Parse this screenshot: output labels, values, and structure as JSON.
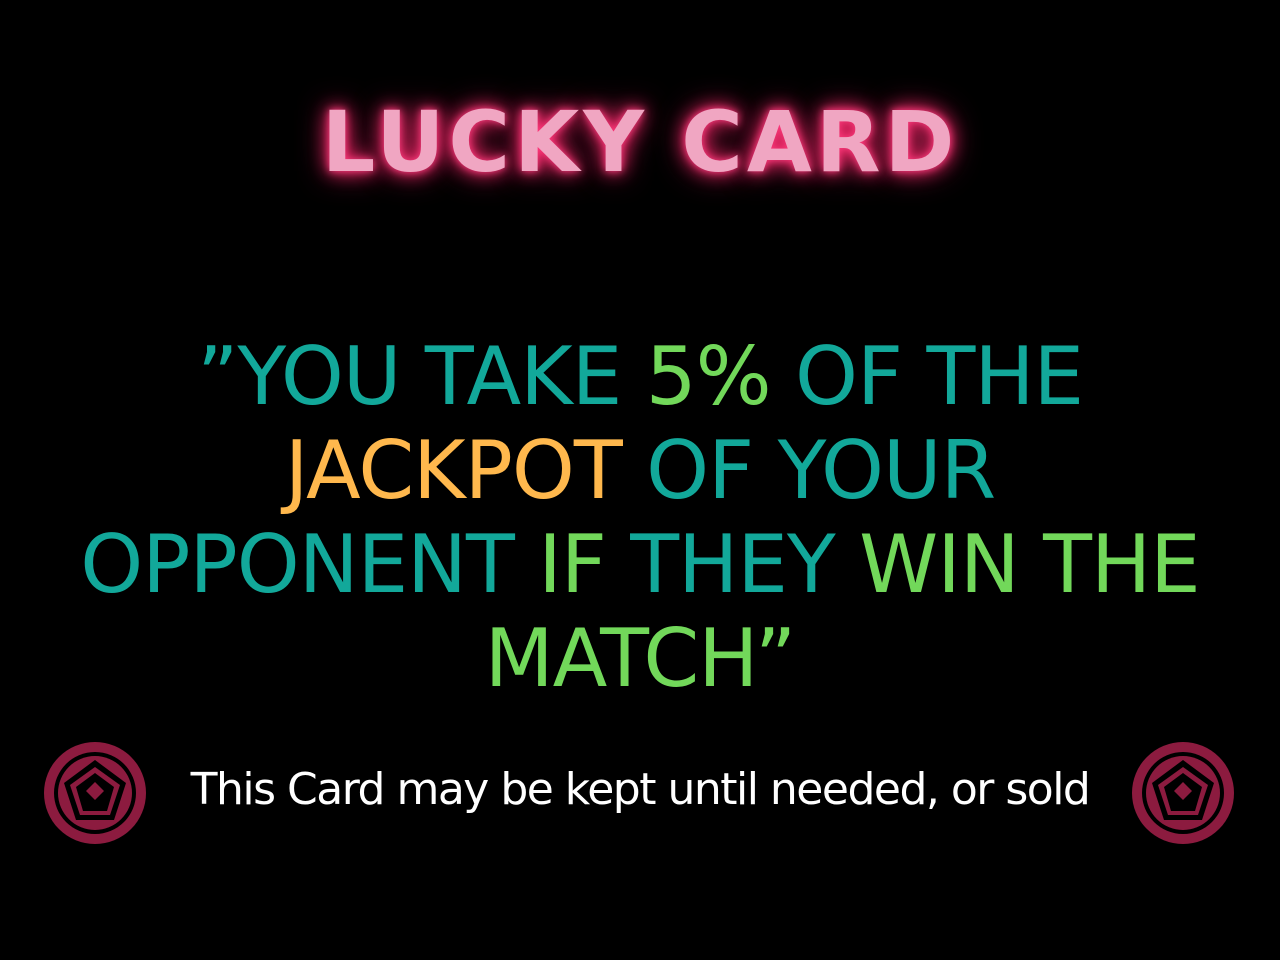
{
  "card": {
    "title": "LUCKY CARD",
    "quote": {
      "line1": [
        {
          "text": "”YOU TAKE ",
          "color": "teal"
        },
        {
          "text": "5%",
          "color": "green"
        },
        {
          "text": " OF THE",
          "color": "teal"
        }
      ],
      "line2": [
        {
          "text": "JACKPOT",
          "color": "orange"
        },
        {
          "text": " OF YOUR",
          "color": "teal"
        }
      ],
      "line3": [
        {
          "text": "OPPONENT ",
          "color": "teal"
        },
        {
          "text": "IF",
          "color": "green"
        },
        {
          "text": " THEY ",
          "color": "teal"
        },
        {
          "text": "WIN THE",
          "color": "green"
        }
      ],
      "line4": [
        {
          "text": "MATCH",
          "color": "green"
        },
        {
          "text": "”",
          "color": "green"
        }
      ]
    },
    "footer": "This Card  may be kept until needed, or sold",
    "emblem_icon": "pentagon-star-emblem-icon"
  },
  "colors": {
    "background": "#000000",
    "title": "#f0a6c2",
    "title_glow": "#ff2a6d",
    "teal": "#12a89a",
    "green": "#72d85a",
    "orange": "#ffb84d",
    "footer": "#ffffff",
    "emblem": "#8c1b3f"
  }
}
